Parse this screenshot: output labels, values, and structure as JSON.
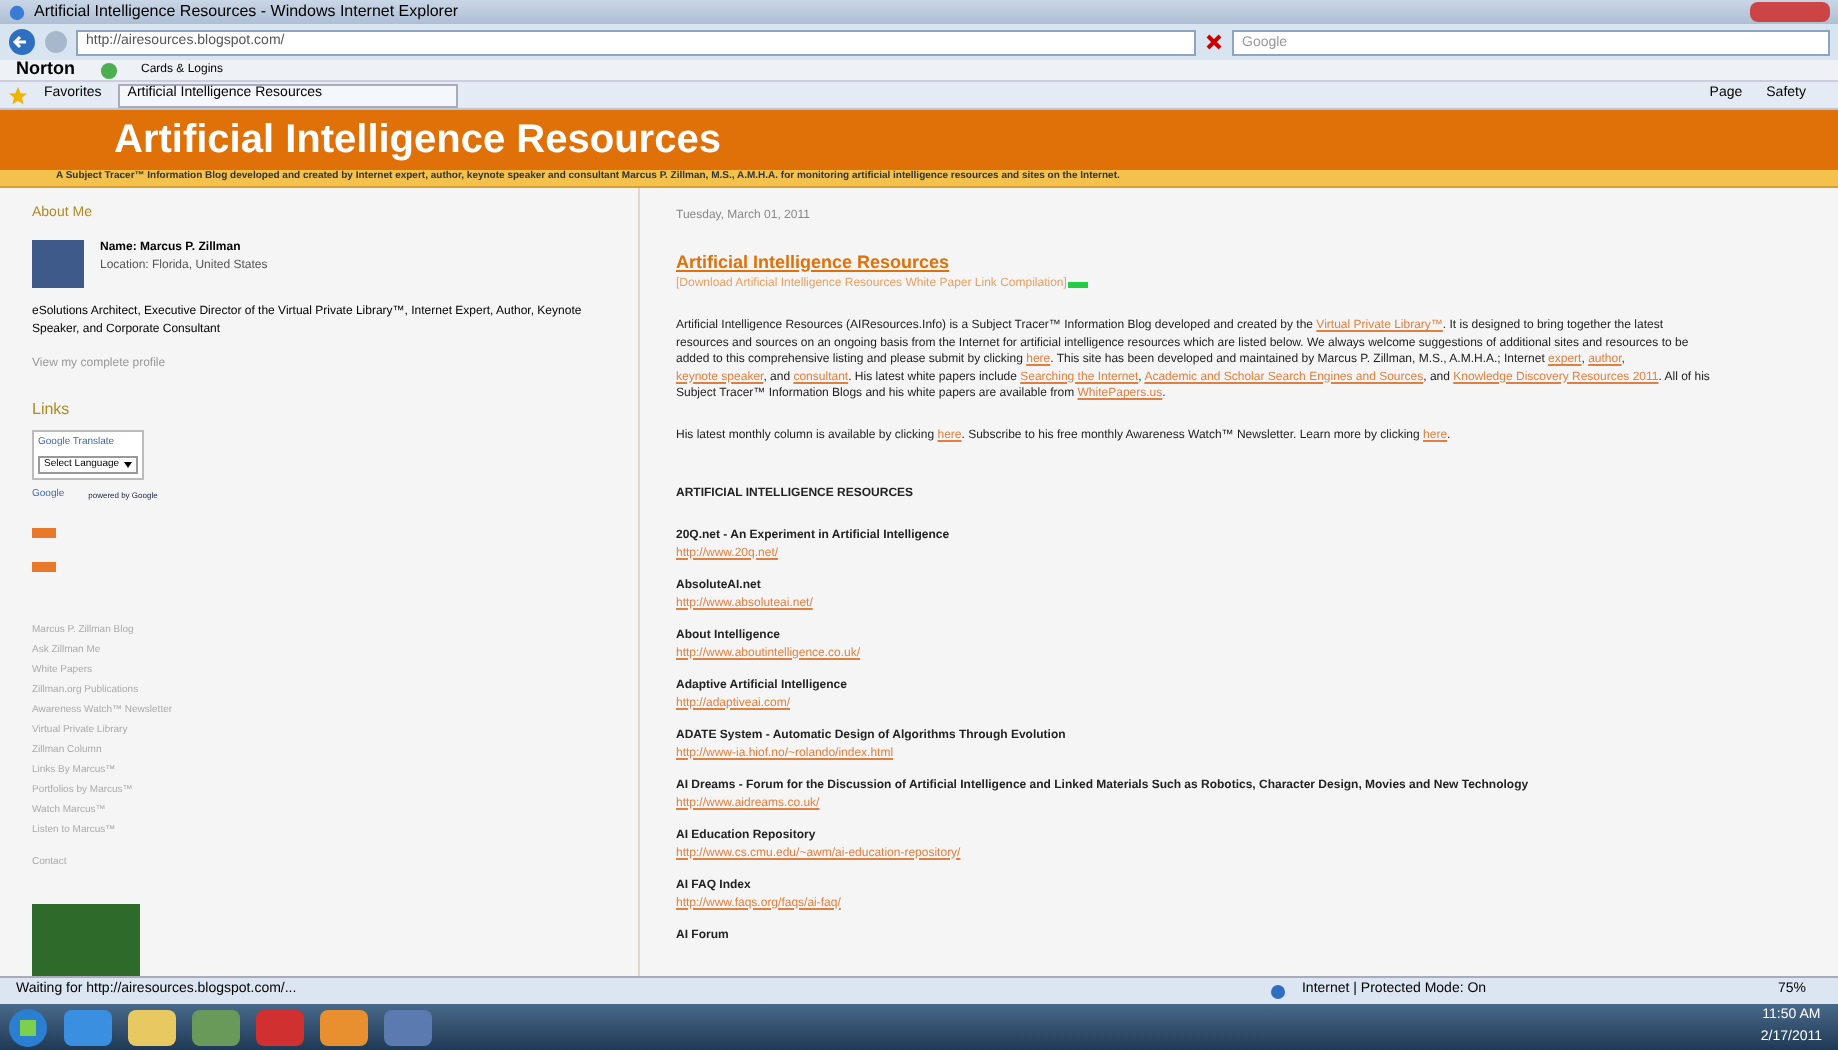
{
  "window": {
    "title": "Artificial Intelligence Resources - Windows Internet Explorer"
  },
  "address_bar": {
    "url": "http://airesources.blogspot.com/",
    "search_placeholder": "Google"
  },
  "norton_bar": {
    "brand": "Norton",
    "items": [
      "Cards & Logins"
    ]
  },
  "favorites_bar": {
    "label": "Favorites",
    "tab": "Artificial Intelligence Resources"
  },
  "command_bar": [
    "Page",
    "Safety"
  ],
  "blog": {
    "title": "Artificial Intelligence Resources",
    "tagline": "A Subject Tracer™ Information Blog developed and created by Internet expert, author, keynote speaker and consultant Marcus P. Zillman, M.S., A.M.H.A. for monitoring artificial intelligence resources and sites on the Internet.",
    "sidebar": {
      "heading": "About Me",
      "name": "Name: Marcus P. Zillman",
      "location": "Location: Florida, United States",
      "bio": "eSolutions Architect, Executive Director of the Virtual Private Library™, Internet Expert, Author, Keynote Speaker, and Corporate Consultant",
      "profile_link": "View my complete profile",
      "links_heading": "Links",
      "translate": {
        "label": "Google Translate",
        "select": "Select Language",
        "button": "Google",
        "credit": "powered by Google"
      },
      "links": [
        "Marcus P. Zillman Blog",
        "Ask Zillman Me",
        "White Papers",
        "Zillman.org Publications",
        "Awareness Watch™ Newsletter",
        "Virtual Private Library",
        "Zillman Column",
        "Links By Marcus™",
        "Portfolios by Marcus™",
        "Watch Marcus™",
        "Listen to Marcus™",
        "Contact"
      ]
    },
    "post": {
      "date": "Tuesday, March 01, 2011",
      "title": "Artificial Intelligence Resources",
      "download_link": "[Download Artificial Intelligence Resources White Paper Link Compilation]",
      "intro": [
        {
          "text": "Artificial Intelligence Resources (AIResources.Info) is a Subject Tracer™ Information Blog developed and created by the ",
          "link": false
        },
        {
          "text": "Virtual Private Library™",
          "link": true
        },
        {
          "text": ". It is designed to bring together the latest resources and sources on an ongoing basis from the Internet for artificial intelligence resources which are listed below. We always welcome suggestions of additional sites and resources to be added to this comprehensive listing and please submit by clicking ",
          "link": false
        },
        {
          "text": "here",
          "link": true
        },
        {
          "text": ". This site has been developed and maintained by Marcus P. Zillman, M.S., A.M.H.A.; Internet ",
          "link": false
        },
        {
          "text": "expert",
          "link": true
        },
        {
          "text": ", ",
          "link": false
        },
        {
          "text": "author",
          "link": true
        },
        {
          "text": ", ",
          "link": false
        },
        {
          "text": "keynote speaker",
          "link": true
        },
        {
          "text": ", and ",
          "link": false
        },
        {
          "text": "consultant",
          "link": true
        },
        {
          "text": ". His latest white papers include ",
          "link": false
        },
        {
          "text": "Searching the Internet",
          "link": true
        },
        {
          "text": ", ",
          "link": false
        },
        {
          "text": "Academic and Scholar Search Engines and Sources",
          "link": true
        },
        {
          "text": ", and ",
          "link": false
        },
        {
          "text": "Knowledge Discovery Resources 2011",
          "link": true
        },
        {
          "text": ". All of his Subject Tracer™ Information Blogs and his white papers are available from ",
          "link": false
        },
        {
          "text": "WhitePapers.us",
          "link": true
        },
        {
          "text": ".",
          "link": false
        }
      ],
      "column_note": [
        {
          "text": "His latest monthly column is available by clicking ",
          "link": false
        },
        {
          "text": "here",
          "link": true
        },
        {
          "text": ". Subscribe to his free monthly Awareness Watch™ Newsletter. Learn more by clicking ",
          "link": false
        },
        {
          "text": "here",
          "link": true
        },
        {
          "text": ".",
          "link": false
        }
      ],
      "section_heading": "ARTIFICIAL INTELLIGENCE RESOURCES",
      "resources": [
        {
          "name": "20Q.net - An Experiment in Artificial Intelligence",
          "url": "http://www.20q.net/"
        },
        {
          "name": "AbsoluteAI.net",
          "url": "http://www.absoluteai.net/"
        },
        {
          "name": "About Intelligence",
          "url": "http://www.aboutintelligence.co.uk/"
        },
        {
          "name": "Adaptive Artificial Intelligence",
          "url": "http://adaptiveai.com/"
        },
        {
          "name": "ADATE System - Automatic Design of Algorithms Through Evolution",
          "url": "http://www-ia.hiof.no/~rolando/index.html"
        },
        {
          "name": "AI Dreams - Forum for the Discussion of Artificial Intelligence and Linked Materials Such as Robotics, Character Design, Movies and New Technology",
          "url": "http://www.aidreams.co.uk/"
        },
        {
          "name": "AI Education Repository",
          "url": "http://www.cs.cmu.edu/~awm/ai-education-repository/"
        },
        {
          "name": "AI FAQ Index",
          "url": "http://www.faqs.org/faqs/ai-faq/"
        },
        {
          "name": "AI Forum"
        }
      ]
    }
  },
  "status_bar": {
    "text": "Waiting for http://airesources.blogspot.com/...",
    "zone": "Internet | Protected Mode: On",
    "zoom": "75%"
  },
  "taskbar": {
    "time": "11:50 AM",
    "date": "2/17/2011"
  }
}
